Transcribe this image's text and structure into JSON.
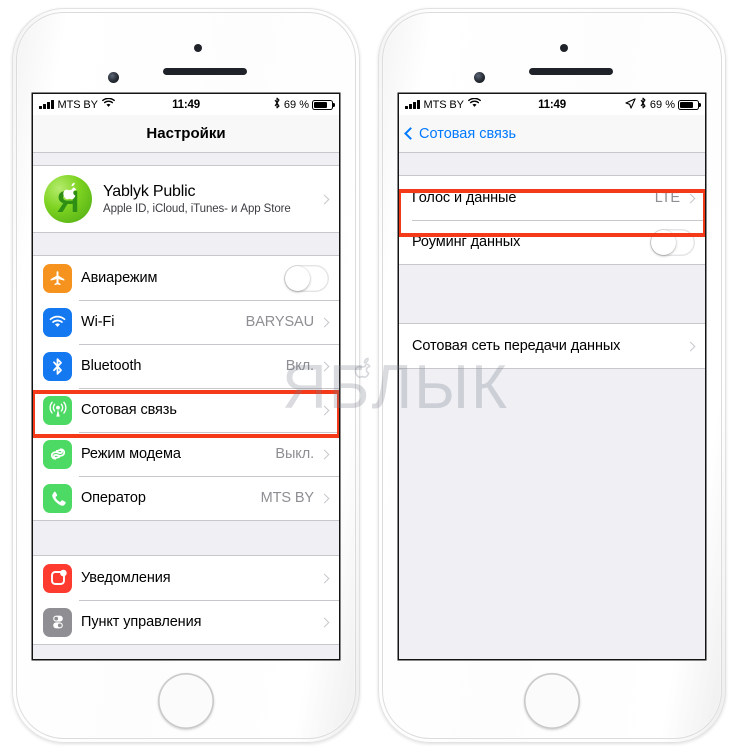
{
  "watermark": {
    "text": "ЯБЛЫК",
    "apple_icon": "apple-logo-icon"
  },
  "status_bar": {
    "signal_icon": "signal-bars-icon",
    "carrier": "MTS BY",
    "wifi_icon": "wifi-icon",
    "time": "11:49",
    "location_icon": "location-arrow-icon",
    "bluetooth_icon": "bluetooth-icon",
    "battery_percent": "69 %",
    "battery_icon": "battery-icon"
  },
  "left_phone": {
    "nav": {
      "title": "Настройки"
    },
    "account": {
      "name": "Yablyk Public",
      "subtitle": "Apple ID, iCloud, iTunes- и App Store",
      "avatar_icon": "yablyk-avatar-icon",
      "chevron_icon": "chevron-right-icon"
    },
    "group1": [
      {
        "label": "Авиарежим",
        "icon": "airplane-icon",
        "icon_color": "#f6921e",
        "control": "toggle",
        "value": ""
      },
      {
        "label": "Wi-Fi",
        "icon": "wifi-icon",
        "icon_color": "#1478f0",
        "control": "value",
        "value": "BARYSAU"
      },
      {
        "label": "Bluetooth",
        "icon": "bluetooth-icon",
        "icon_color": "#1478f0",
        "control": "value",
        "value": "Вкл."
      },
      {
        "label": "Сотовая связь",
        "icon": "cellular-antenna-icon",
        "icon_color": "#4cd964",
        "control": "value",
        "value": "",
        "highlighted": true
      },
      {
        "label": "Режим модема",
        "icon": "hotspot-link-icon",
        "icon_color": "#4cd964",
        "control": "value",
        "value": "Выкл."
      },
      {
        "label": "Оператор",
        "icon": "phone-handset-icon",
        "icon_color": "#4cd964",
        "control": "value",
        "value": "MTS BY"
      }
    ],
    "group2": [
      {
        "label": "Уведомления",
        "icon": "notifications-icon",
        "icon_color": "#ff3b30",
        "control": "value",
        "value": ""
      },
      {
        "label": "Пункт управления",
        "icon": "control-center-icon",
        "icon_color": "#8e8e93",
        "control": "value",
        "value": ""
      }
    ]
  },
  "right_phone": {
    "nav": {
      "back_label": "Сотовая связь",
      "back_icon": "chevron-left-icon",
      "title": ""
    },
    "group1": [
      {
        "label": "Голос и данные",
        "control": "value",
        "value": "LTE",
        "highlighted": true
      },
      {
        "label": "Роуминг данных",
        "control": "toggle",
        "value": ""
      }
    ],
    "group2": [
      {
        "label": "Сотовая сеть передачи данных",
        "control": "value",
        "value": ""
      }
    ]
  },
  "colors": {
    "highlight": "#f43a18",
    "ios_blue": "#007aff",
    "list_bg": "#efeff4",
    "separator": "#c8c7cc",
    "secondary_text": "#8e8e93"
  }
}
